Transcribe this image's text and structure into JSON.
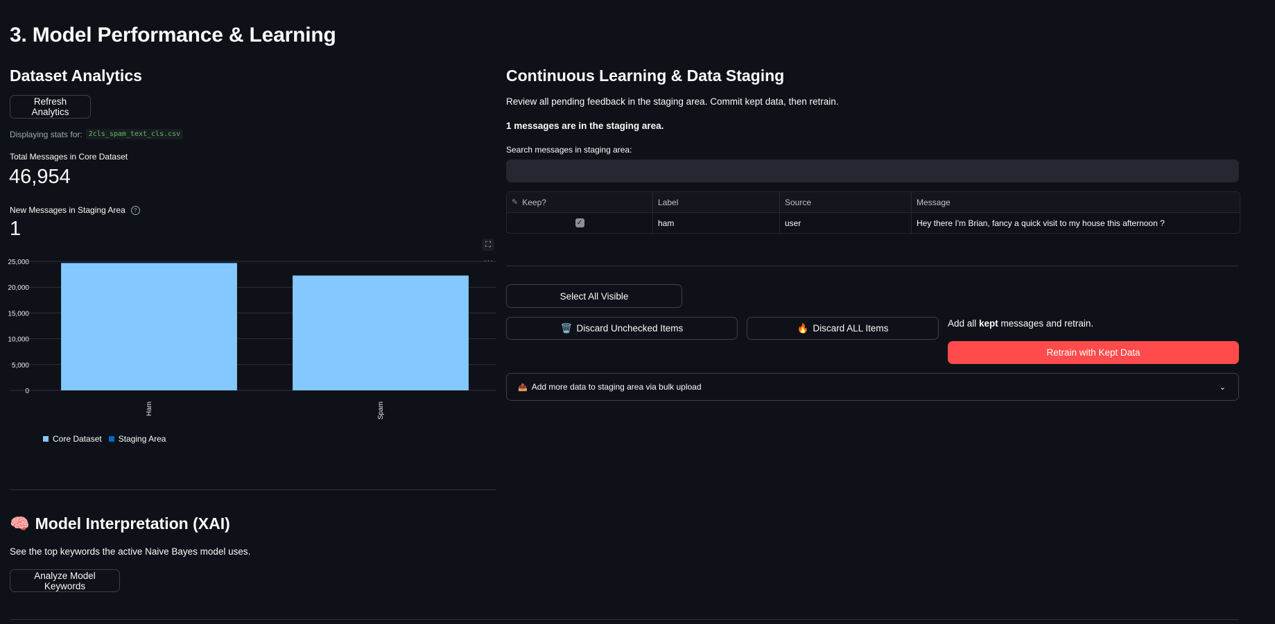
{
  "page": {
    "title": "3. Model Performance & Learning"
  },
  "analytics": {
    "heading": "Dataset Analytics",
    "refresh_label": "Refresh Analytics",
    "displaying_prefix": "Displaying stats for:",
    "file_name": "2cls_spam_text_cls.csv",
    "total_label": "Total Messages in Core Dataset",
    "total_value": "46,954",
    "new_label": "New Messages in Staging Area",
    "new_value": "1"
  },
  "chart_data": {
    "type": "bar",
    "categories": [
      "Ham",
      "Spam"
    ],
    "series": [
      {
        "name": "Core Dataset",
        "values": [
          24700,
          22254
        ],
        "color": "#83c9ff"
      },
      {
        "name": "Staging Area",
        "values": [
          1,
          0
        ],
        "color": "#0068c9"
      }
    ],
    "stacked": true,
    "ylim": [
      0,
      25000
    ],
    "yticks": [
      "25,000",
      "20,000",
      "15,000",
      "10,000",
      "5,000",
      "0"
    ],
    "ytick_values": [
      25000,
      20000,
      15000,
      10000,
      5000,
      0
    ],
    "grid": true,
    "legend": "bottom-left"
  },
  "xai": {
    "icon": "🧠",
    "heading": "Model Interpretation (XAI)",
    "desc": "See the top keywords the active Naive Bayes model uses.",
    "button": "Analyze Model Keywords"
  },
  "staging": {
    "heading": "Continuous Learning & Data Staging",
    "desc": "Review all pending feedback in the staging area. Commit kept data, then retrain.",
    "count_text": "1 messages are in the staging area.",
    "search_label": "Search messages in staging area:",
    "search_value": "",
    "columns": [
      "Keep?",
      "Label",
      "Source",
      "Message"
    ],
    "rows": [
      {
        "keep": true,
        "label": "ham",
        "source": "user",
        "message": "Hey there I'm Brian, fancy a quick visit to my house this afternoon ?"
      }
    ],
    "select_all": "Select All Visible",
    "discard_unchecked": "Discard Unchecked Items",
    "discard_unchecked_icon": "🗑️",
    "discard_all": "Discard ALL Items",
    "discard_all_icon": "🔥",
    "retrain_pre": "Add all ",
    "retrain_bold": "kept",
    "retrain_post": " messages and retrain.",
    "retrain_button": "Retrain with Kept Data",
    "bulk_icon": "📤",
    "bulk_label": "Add more data to staging area via bulk upload"
  },
  "colors": {
    "accent": "#ff4b4b",
    "background": "#0e1117",
    "core_bar": "#83c9ff",
    "staging_bar": "#0068c9"
  }
}
